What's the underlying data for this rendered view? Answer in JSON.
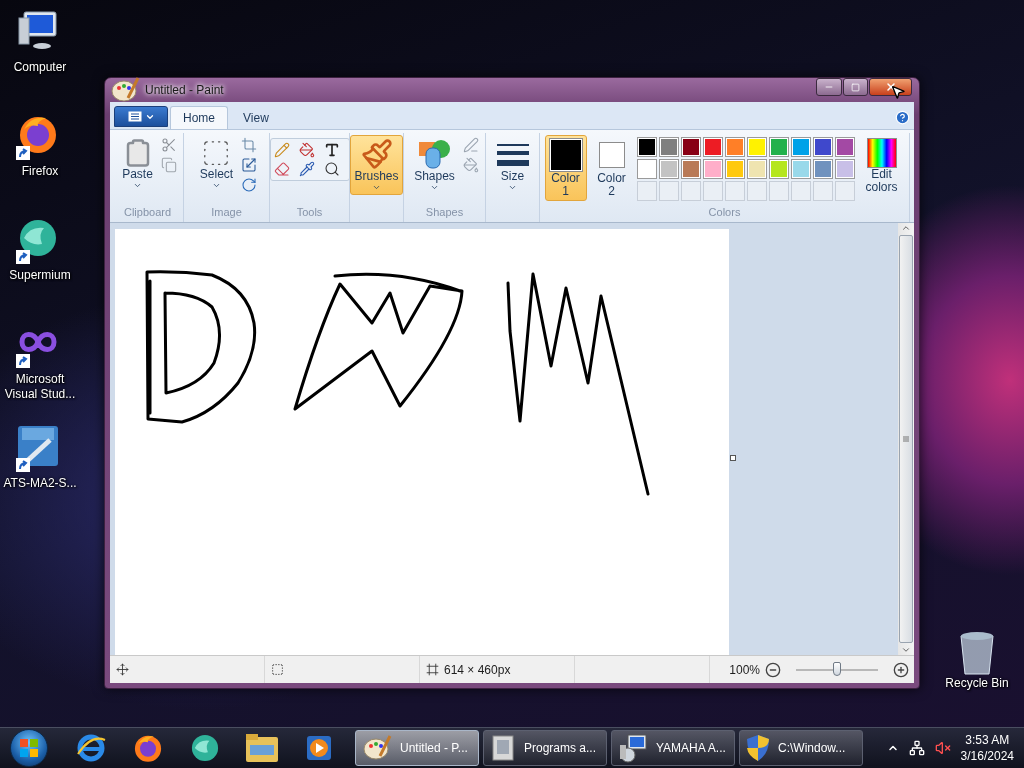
{
  "desktop_icons": [
    {
      "label": "Computer",
      "kind": "computer",
      "shortcut": false
    },
    {
      "label": "Firefox",
      "kind": "firefox",
      "shortcut": true
    },
    {
      "label": "Supermium",
      "kind": "supermium",
      "shortcut": true
    },
    {
      "label": "Microsoft Visual Stud...",
      "kind": "vs",
      "shortcut": true
    },
    {
      "label": "ATS-MA2-S...",
      "kind": "ma2",
      "shortcut": true
    }
  ],
  "recycle_bin": {
    "label": "Recycle Bin"
  },
  "window": {
    "title": "Untitled - Paint"
  },
  "ribbon": {
    "tabs": [
      {
        "label": "Home",
        "selected": true
      },
      {
        "label": "View",
        "selected": false
      }
    ],
    "clipboard": {
      "paste": "Paste",
      "label": "Clipboard"
    },
    "image": {
      "select": "Select",
      "label": "Image"
    },
    "tools": {
      "label": "Tools"
    },
    "brushes": {
      "button": "Brushes",
      "selected": true
    },
    "shapes": {
      "button": "Shapes",
      "label": "Shapes"
    },
    "size": {
      "button": "Size"
    },
    "colors": {
      "label": "Colors",
      "edit": "Edit colors",
      "color1": {
        "label": "Color 1",
        "color": "#000000",
        "selected": true
      },
      "color2": {
        "label": "Color 2",
        "color": "#ffffff",
        "selected": false
      },
      "palette": [
        {
          "kind": "swatch",
          "color": "#000000"
        },
        {
          "kind": "swatch",
          "color": "#7f7f7f"
        },
        {
          "kind": "swatch",
          "color": "#880015"
        },
        {
          "kind": "swatch",
          "color": "#ed1c24"
        },
        {
          "kind": "swatch",
          "color": "#ff7f27"
        },
        {
          "kind": "swatch",
          "color": "#fff200"
        },
        {
          "kind": "swatch",
          "color": "#22b14c"
        },
        {
          "kind": "swatch",
          "color": "#00a2e8"
        },
        {
          "kind": "swatch",
          "color": "#3f48cc"
        },
        {
          "kind": "swatch",
          "color": "#a349a4"
        },
        {
          "kind": "swatch",
          "color": "#ffffff"
        },
        {
          "kind": "swatch",
          "color": "#c3c3c3"
        },
        {
          "kind": "swatch",
          "color": "#b97a57"
        },
        {
          "kind": "swatch",
          "color": "#ffaec9"
        },
        {
          "kind": "swatch",
          "color": "#ffc90e"
        },
        {
          "kind": "swatch",
          "color": "#efe4b0"
        },
        {
          "kind": "swatch",
          "color": "#b5e61d"
        },
        {
          "kind": "swatch",
          "color": "#99d9ea"
        },
        {
          "kind": "swatch",
          "color": "#7092be"
        },
        {
          "kind": "swatch",
          "color": "#c8bfe7"
        },
        {
          "kind": "empty"
        },
        {
          "kind": "empty"
        },
        {
          "kind": "empty"
        },
        {
          "kind": "empty"
        },
        {
          "kind": "empty"
        },
        {
          "kind": "empty"
        },
        {
          "kind": "empty"
        },
        {
          "kind": "empty"
        },
        {
          "kind": "empty"
        },
        {
          "kind": "empty"
        }
      ]
    }
  },
  "status_bar": {
    "canvas_size": "614 × 460px",
    "zoom": "100%",
    "zoom_slider": {
      "level": 0.5
    }
  },
  "taskbar": {
    "pinned": [
      {
        "kind": "ie"
      },
      {
        "kind": "firefox"
      },
      {
        "kind": "supermium"
      },
      {
        "kind": "explorer"
      },
      {
        "kind": "media"
      }
    ],
    "tasks": [
      {
        "label": "Untitled - P...",
        "kind": "paint",
        "selected": true
      },
      {
        "label": "Programs a...",
        "kind": "programs",
        "selected": false
      },
      {
        "label": "YAMAHA A...",
        "kind": "setup",
        "selected": false
      },
      {
        "label": "C:\\Window...",
        "kind": "shield",
        "selected": false
      }
    ],
    "clock": {
      "time": "3:53 AM",
      "date": "3/16/2024"
    }
  }
}
